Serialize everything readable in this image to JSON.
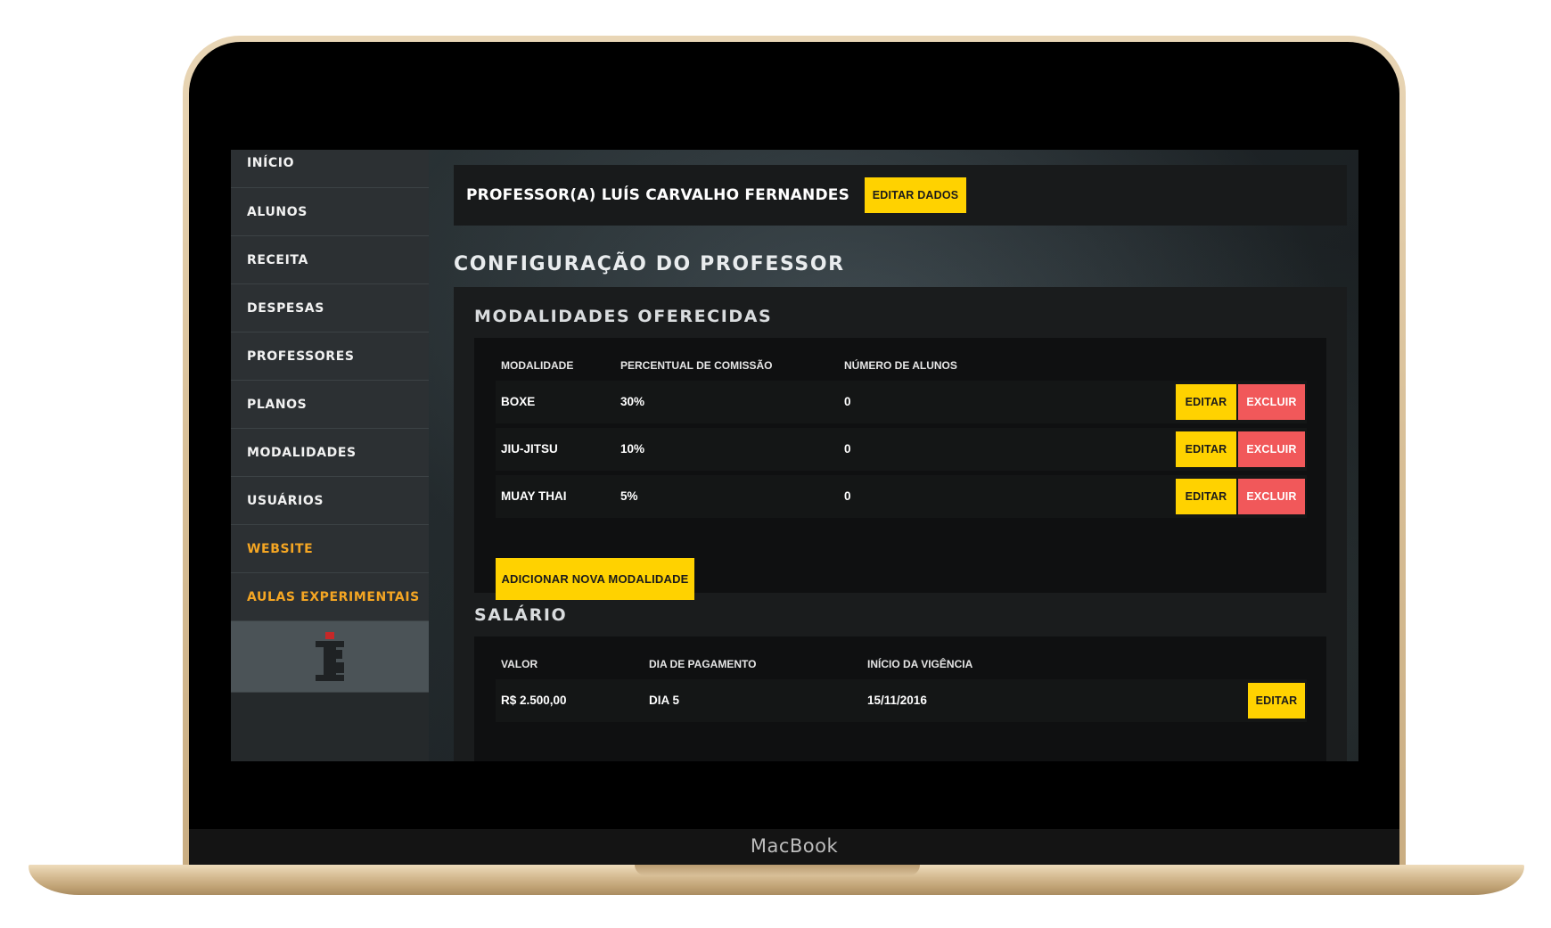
{
  "device": {
    "brand": "MacBook"
  },
  "sidebar": {
    "items": [
      {
        "label": "INÍCIO"
      },
      {
        "label": "ALUNOS"
      },
      {
        "label": "RECEITA"
      },
      {
        "label": "DESPESAS"
      },
      {
        "label": "PROFESSORES"
      },
      {
        "label": "PLANOS"
      },
      {
        "label": "MODALIDADES"
      },
      {
        "label": "USUÁRIOS"
      },
      {
        "label": "WEBSITE"
      },
      {
        "label": "AULAS EXPERIMENTAIS"
      }
    ],
    "accent_color": "#f5a623"
  },
  "header": {
    "professor_name": "PROFESSOR(A) LUÍS CARVALHO FERNANDES",
    "edit_button": "EDITAR DADOS"
  },
  "page_title": "CONFIGURAÇÃO DO PROFESSOR",
  "modalities": {
    "title": "MODALIDADES OFERECIDAS",
    "columns": [
      "MODALIDADE",
      "PERCENTUAL DE COMISSÃO",
      "NÚMERO DE ALUNOS"
    ],
    "rows": [
      {
        "name": "BOXE",
        "commission": "30%",
        "students": "0",
        "edit": "EDITAR",
        "delete": "EXCLUIR"
      },
      {
        "name": "JIU-JITSU",
        "commission": "10%",
        "students": "0",
        "edit": "EDITAR",
        "delete": "EXCLUIR"
      },
      {
        "name": "MUAY THAI",
        "commission": "5%",
        "students": "0",
        "edit": "EDITAR",
        "delete": "EXCLUIR"
      }
    ],
    "add_button": "ADICIONAR NOVA MODALIDADE"
  },
  "salary": {
    "title": "SALÁRIO",
    "columns": [
      "VALOR",
      "DIA DE PAGAMENTO",
      "INÍCIO DA VIGÊNCIA"
    ],
    "rows": [
      {
        "value": "R$ 2.500,00",
        "payday": "DIA 5",
        "start": "15/11/2016",
        "edit": "EDITAR"
      }
    ]
  },
  "colors": {
    "button_yellow": "#ffd200",
    "button_red": "#f1585a"
  }
}
